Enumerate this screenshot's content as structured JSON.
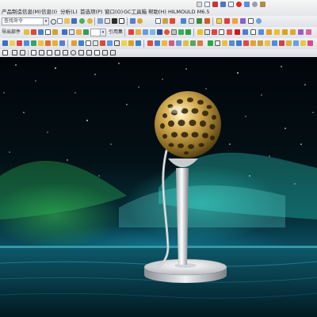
{
  "menubar": {
    "items": [
      {
        "label": "产品制造信息(M)"
      },
      {
        "label": "信息(I)"
      },
      {
        "label": "分析(L)"
      },
      {
        "label": "首选项(P)"
      },
      {
        "label": "窗口(O)"
      },
      {
        "label": "GC工具箱"
      },
      {
        "label": "帮助(H)"
      },
      {
        "label": "HILMOULD M6.5"
      }
    ]
  },
  "toolbar1": {
    "search_placeholder": "查找命令"
  },
  "toolbar2": {
    "left_label": "导出部件",
    "ref_set_label": "引用集"
  },
  "colors": {
    "menubar_bg": "#ececee",
    "toolbar_bg": "#e4e6ea",
    "trophy_gold": "#c9a24a",
    "trophy_silver": "#d8dadd"
  },
  "icons": [
    "new-icon",
    "open-icon",
    "save-icon",
    "undo-icon",
    "redo-icon",
    "cut-icon",
    "copy-icon",
    "paste-icon",
    "delete-icon",
    "render-icon",
    "fit-icon",
    "zoom-icon",
    "rotate-icon",
    "snap-icon",
    "layer-icon",
    "part-icon",
    "assembly-icon",
    "feature-icon",
    "sketch-icon",
    "extrude-icon",
    "mold-icon",
    "check-icon",
    "shading-icon",
    "wireframe-icon",
    "view-icon",
    "select-icon"
  ]
}
